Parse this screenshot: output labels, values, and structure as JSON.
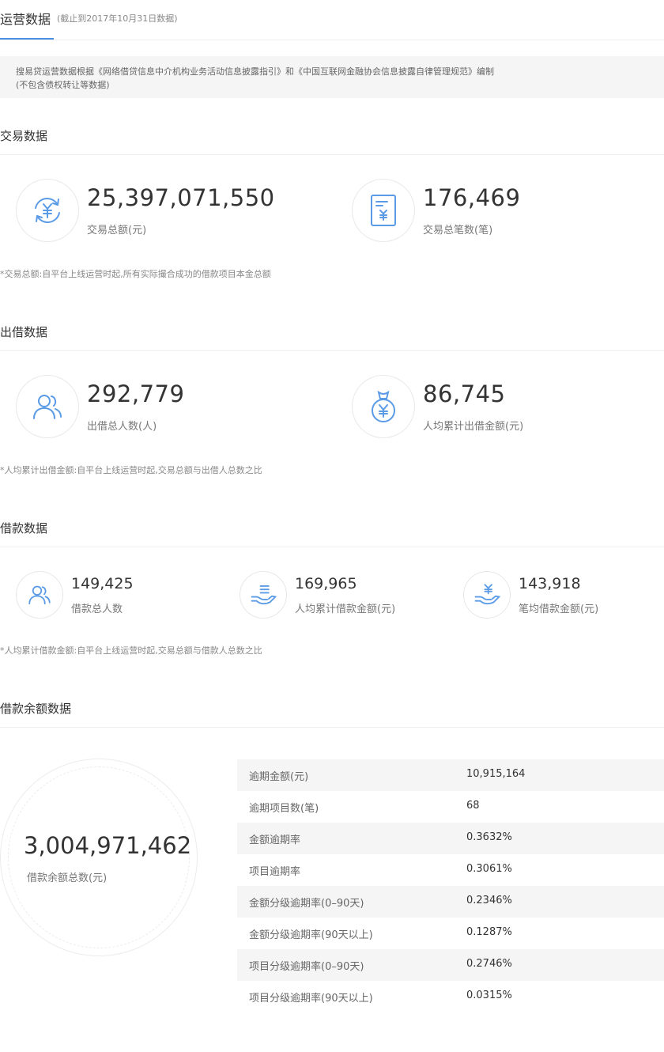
{
  "header": {
    "title": "运营数据",
    "subtitle": "(截止到2017年10月31日数据)"
  },
  "notice": {
    "line1": "搜易贷运营数据根据《网络借贷信息中介机构业务活动信息披露指引》和《中国互联网金融协会信息披露自律管理规范》编制",
    "line2": "(不包含债权转让等数据)"
  },
  "transaction": {
    "title": "交易数据",
    "total_amount": {
      "value": "25,397,071,550",
      "label": "交易总额(元)"
    },
    "total_count": {
      "value": "176,469",
      "label": "交易总笔数(笔)"
    },
    "footnote": "*交易总额:自平台上线运营时起,所有实际撮合成功的借款项目本金总额"
  },
  "lending": {
    "title": "出借数据",
    "lenders": {
      "value": "292,779",
      "label": "出借总人数(人)"
    },
    "avg_amount": {
      "value": "86,745",
      "label": "人均累计出借金额(元)"
    },
    "footnote": "*人均累计出借金额:自平台上线运营时起,交易总额与出借人总数之比"
  },
  "borrowing": {
    "title": "借款数据",
    "borrowers": {
      "value": "149,425",
      "label": "借款总人数"
    },
    "avg_per_person": {
      "value": "169,965",
      "label": "人均累计借款金额(元)"
    },
    "avg_per_loan": {
      "value": "143,918",
      "label": "笔均借款金额(元)"
    },
    "footnote": "*人均累计借款金额:自平台上线运营时起,交易总额与借款人总数之比"
  },
  "balance": {
    "title": "借款余额数据",
    "total": {
      "value": "3,004,971,462",
      "label": "借款余额总数(元)"
    },
    "rows": [
      {
        "label": "逾期金额(元)",
        "value": "10,915,164"
      },
      {
        "label": "逾期项目数(笔)",
        "value": "68"
      },
      {
        "label": "金额逾期率",
        "value": "0.3632%"
      },
      {
        "label": "项目逾期率",
        "value": "0.3061%"
      },
      {
        "label": "金额分级逾期率(0–90天)",
        "value": "0.2346%"
      },
      {
        "label": "金额分级逾期率(90天以上)",
        "value": "0.1287%"
      },
      {
        "label": "项目分级逾期率(0–90天)",
        "value": "0.2746%"
      },
      {
        "label": "项目分级逾期率(90天以上)",
        "value": "0.0315%"
      }
    ]
  },
  "colors": {
    "accent": "#4a90e2",
    "icon": "#5b9be6"
  },
  "icons": [
    "exchange-yuan-icon",
    "document-yuan-icon",
    "users-icon",
    "money-bag-icon",
    "user-icon",
    "hand-coins-icon",
    "hand-yuan-icon"
  ]
}
